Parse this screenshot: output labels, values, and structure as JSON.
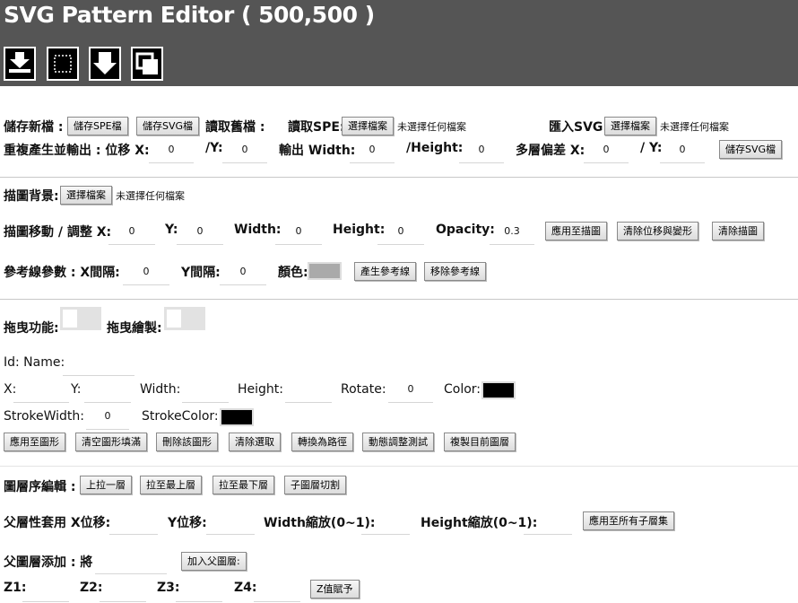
{
  "header": {
    "title": "SVG Pattern Editor ( 500,500 )"
  },
  "toolbar": {
    "tools": [
      {
        "icon": "download-icon"
      },
      {
        "icon": "marquee-select-icon"
      },
      {
        "icon": "arrow-down-icon"
      },
      {
        "icon": "layers-icon"
      }
    ]
  },
  "file_row": {
    "save_new_label": "儲存新檔 :",
    "save_spe_button": "儲存SPE檔",
    "save_svg_button": "儲存SVG檔",
    "read_old_label": "讀取舊檔 :",
    "read_spe_label": "讀取SPE:",
    "import_svg_label": "匯入SVG:",
    "choose_file_button": "選擇檔案",
    "no_file_text": "未選擇任何檔案"
  },
  "regen_row": {
    "label": "重複產生並輸出 : 位移 X:",
    "x_value": "0",
    "y_label": "/Y:",
    "y_value": "0",
    "width_label": "輸出 Width:",
    "width_value": "0",
    "height_label": "/Height:",
    "height_value": "0",
    "offset_label": "多層偏差 X:",
    "offset_x_value": "0",
    "offset_y_label": "/ Y:",
    "offset_y_value": "0",
    "save_svg_button": "儲存SVG檔"
  },
  "trace": {
    "bg_label": "描圖背景:",
    "choose_file_button": "選擇檔案",
    "no_file_text": "未選擇任何檔案",
    "move_label": "描圖移動 / 調整 X:",
    "x_value": "0",
    "y_label": "Y:",
    "y_value": "0",
    "width_label": "Width:",
    "width_value": "0",
    "height_label": "Height:",
    "height_value": "0",
    "opacity_label": "Opacity:",
    "opacity_value": "0.3",
    "apply_button": "應用至描圖",
    "clear_transform_button": "清除位移與變形",
    "clear_trace_button": "清除描圖"
  },
  "guides": {
    "label": "參考線參數 :  X間隔:",
    "x_gap_value": "0",
    "y_gap_label": "Y間隔:",
    "y_gap_value": "0",
    "color_label": "顏色:",
    "color": "#aaaaaa",
    "generate_button": "產生參考線",
    "remove_button": "移除參考線"
  },
  "drag": {
    "drag_label": "拖曳功能:",
    "drag_draw_label": "拖曳繪製:"
  },
  "shape": {
    "id_name_label": "Id: Name:",
    "x_label": "X:",
    "y_label": "Y:",
    "width_label": "Width:",
    "height_label": "Height:",
    "rotate_label": "Rotate:",
    "rotate_value": "0",
    "color_label": "Color:",
    "color": "#000000",
    "stroke_width_label": "StrokeWidth:",
    "stroke_width_value": "0",
    "stroke_color_label": "StrokeColor:",
    "stroke_color": "#000000",
    "buttons": [
      "應用至圖形",
      "清空圖形填滿",
      "刪除該圖形",
      "清除選取",
      "轉換為路徑",
      "動態調整測試",
      "複製目前圖層"
    ]
  },
  "layers": {
    "order_label": "圖層序編輯 :",
    "order_buttons": [
      "上拉一層",
      "拉至最上層",
      "拉至最下層",
      "子圖層切割"
    ],
    "parent_apply_label": "父層性套用 X位移:",
    "y_offset_label": "Y位移:",
    "width_scale_label": "Width縮放(0~1):",
    "height_scale_label": "Height縮放(0~1):",
    "apply_children_button": "應用至所有子層集",
    "parent_add_label": "父圖層添加 : 將",
    "add_parent_button": "加入父圖層:",
    "z1_label": "Z1:",
    "z2_label": "Z2:",
    "z3_label": "Z3:",
    "z4_label": "Z4:",
    "z_assign_button": "Z值賦予"
  }
}
